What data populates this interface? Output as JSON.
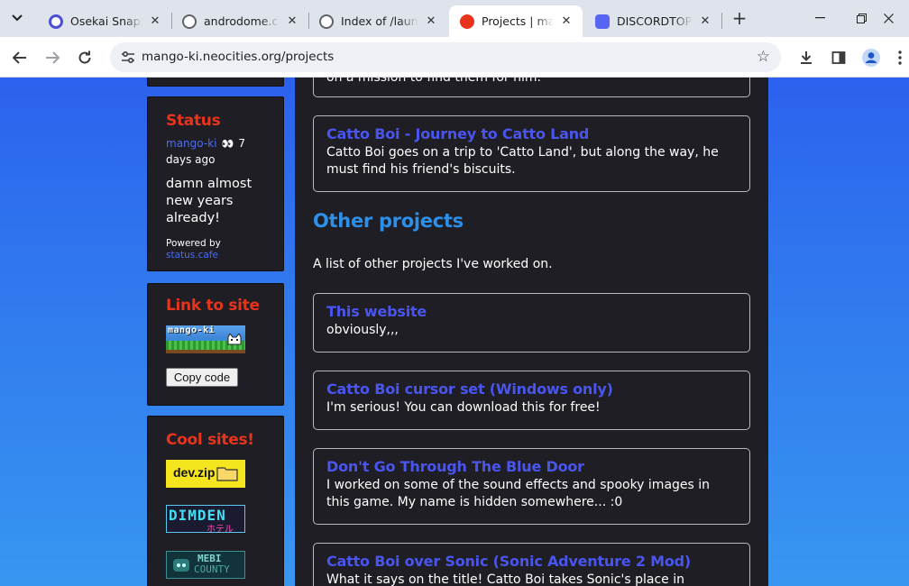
{
  "browser": {
    "tabs": [
      {
        "title": "Osekai Snapshots",
        "favicon_color": "#4b4fd6",
        "active": false
      },
      {
        "title": "androdome.com",
        "favicon_color": "#5f6368",
        "active": false
      },
      {
        "title": "Index of /launcher",
        "favicon_color": "#5f6368",
        "active": false
      },
      {
        "title": "Projects | mango-ki",
        "favicon_color": "#e8331d",
        "active": true
      },
      {
        "title": "DISCORDTOP -",
        "favicon_color": "#5865f2",
        "active": false
      }
    ],
    "url": "mango-ki.neocities.org/projects",
    "icons": {
      "back": "back-arrow-icon",
      "forward": "forward-arrow-icon",
      "reload": "reload-icon",
      "site_info": "tune-icon",
      "bookmark": "star-icon",
      "download": "download-icon",
      "side_panel": "side-panel-icon",
      "profile": "profile-icon",
      "menu": "kebab-menu-icon"
    }
  },
  "sidebar": {
    "status": {
      "heading": "Status",
      "user": "mango-ki",
      "emoji": "👀",
      "time_prefix": "7",
      "time_suffix": "days ago",
      "text": "damn almost new years already!",
      "powered_by": "Powered by",
      "powered_link": "status.cafe"
    },
    "link_to_site": {
      "heading": "Link to site",
      "button_text": "mango-ki",
      "copy_label": "Copy code"
    },
    "cool_sites": {
      "heading": "Cool sites!",
      "badges": [
        {
          "label": "dev.zip",
          "bg": "#f4e51e"
        },
        {
          "label": "DIMDEN",
          "sub": "ホテル",
          "bg": "#1a1a30"
        },
        {
          "label": "MEBI",
          "sub": "COUNTY",
          "bg": "#12333a"
        }
      ]
    }
  },
  "main": {
    "top_fragment": "on a mission to find them for him.",
    "catto_land": {
      "title": "Catto Boi - Journey to Catto Land",
      "desc": "Catto Boi goes on a trip to 'Catto Land', but along the way, he must find his friend's biscuits."
    },
    "other_heading": "Other projects",
    "other_intro": "A list of other projects I've worked on.",
    "projects": [
      {
        "title": "This website",
        "desc": "obviously,,,"
      },
      {
        "title": "Catto Boi cursor set (Windows only)",
        "desc": "I'm serious! You can download this for free!"
      },
      {
        "title": "Don't Go Through The Blue Door",
        "desc": "I worked on some of the sound effects and spooky images in this game. My name is hidden somewhere... :0"
      },
      {
        "title": "Catto Boi over Sonic (Sonic Adventure 2 Mod)",
        "desc": "What it says on the title! Catto Boi takes Sonic's place in"
      }
    ]
  }
}
